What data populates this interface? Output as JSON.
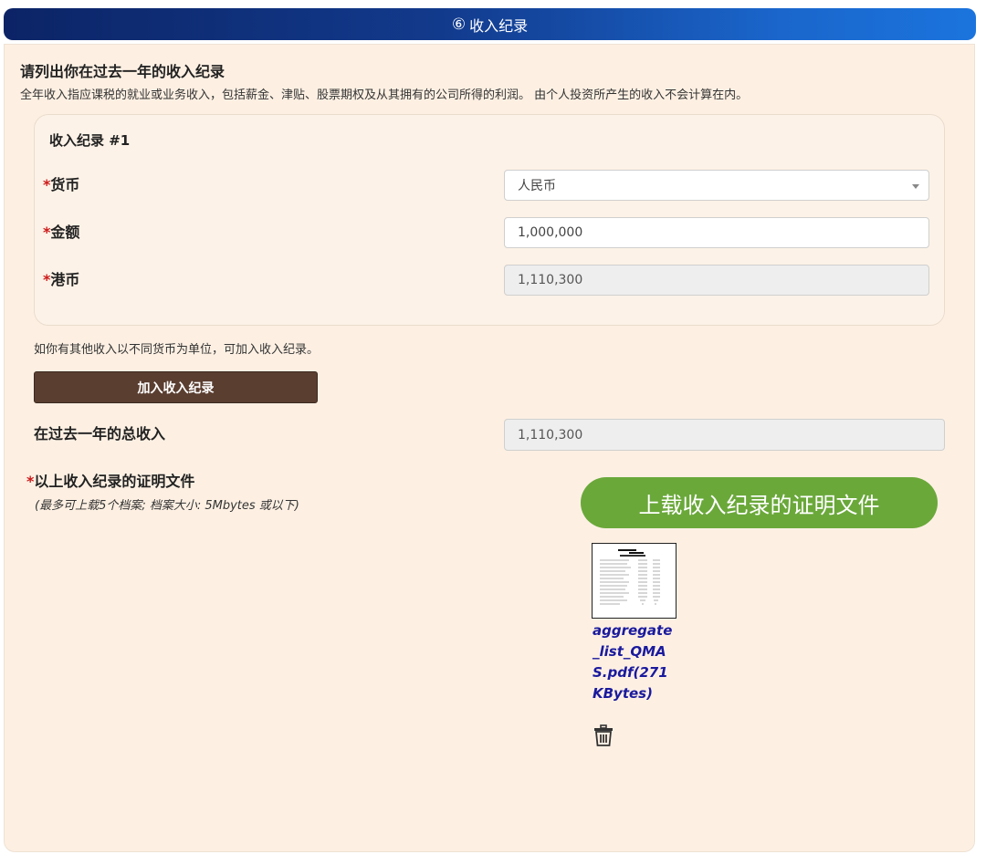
{
  "header": {
    "step_number": "⑥",
    "title": "收入纪录"
  },
  "section": {
    "title": "请列出你在过去一年的收入纪录",
    "description": "全年收入指应课税的就业或业务收入，包括薪金、津贴、股票期权及从其拥有的公司所得的利润。 由个人投资所产生的收入不会计算在内。"
  },
  "record": {
    "title": "收入纪录 #1",
    "required_mark": "*",
    "currency": {
      "label": "货币",
      "value": "人民币"
    },
    "amount": {
      "label": "金额",
      "value": "1,000,000"
    },
    "hkd": {
      "label": "港币",
      "value": "1,110,300"
    }
  },
  "hint": "如你有其他收入以不同货币为单位，可加入收入纪录。",
  "add_button_label": "加入收入纪录",
  "total": {
    "label": "在过去一年的总收入",
    "value": "1,110,300"
  },
  "proof": {
    "required_mark": "*",
    "label": "以上收入纪录的证明文件",
    "note": "(最多可上载5个档案; 档案大小: 5Mbytes 或以下)",
    "upload_button_label": "上载收入纪录的证明文件",
    "file": {
      "name": "aggregate_list_QMAS.pdf",
      "size": "(271KBytes)",
      "thumbnail_icon": "pdf-thumbnail",
      "delete_icon": "trash-icon"
    }
  },
  "colors": {
    "header_start": "#0c2466",
    "header_end": "#1b74dd",
    "panel_bg": "#fdf0e3",
    "add_button": "#5a3e30",
    "upload_button": "#6aa83a",
    "link": "#1a1a9e",
    "required": "#cc1a1a"
  }
}
